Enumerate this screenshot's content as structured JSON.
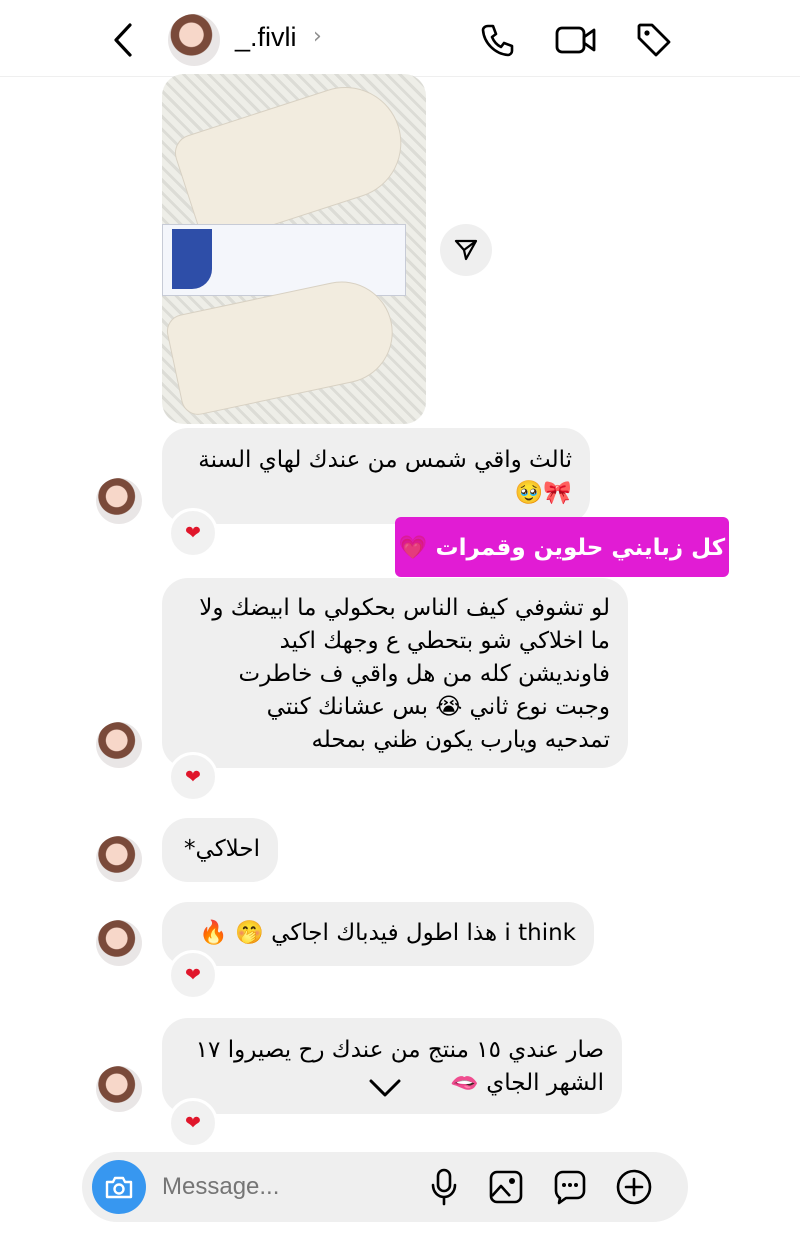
{
  "header": {
    "username": "_.fivli",
    "chevron": "›"
  },
  "icons": {
    "back": "chevron-left-icon",
    "call": "phone-icon",
    "video": "video-camera-icon",
    "tag": "tag-icon",
    "share": "send-icon",
    "camera": "camera-icon",
    "mic": "microphone-icon",
    "gallery": "image-icon",
    "sticker": "sticker-icon",
    "add": "plus-icon"
  },
  "messages": [
    {
      "lines": [
        "ثالث واقي شمس من عندك لهاي السنة",
        "🎀🥹"
      ],
      "reaction": "❤"
    },
    {
      "lines": [
        "لو تشوفي كيف الناس بحكولي ما ابيضك ولا",
        "ما اخلاكي شو بتحطي ع وجهك اكيد",
        "فاونديشن كله من هل واقي ف خاطرت",
        "وجبت نوع ثاني 😭 بس عشانك كنتي",
        "تمدحيه ويارب يكون ظني بمحله"
      ],
      "reaction": "❤"
    },
    {
      "lines": [
        "احلاكي*"
      ],
      "reaction": ""
    },
    {
      "lines": [
        "i think هذا اطول فيدباك اجاكي 🤭 🔥"
      ],
      "reaction": "❤"
    },
    {
      "lines": [
        "صار عندي ١٥ منتج من عندك رح يصيروا ١٧",
        "الشهر الجاي 🫦"
      ],
      "reaction": "❤"
    }
  ],
  "note": "كل زبايني حلوين وقمرات 💗",
  "composer": {
    "placeholder": "Message..."
  },
  "colors": {
    "accent": "#3797f0",
    "note_bg": "#e11cd4",
    "bubble_bg": "#efefef",
    "heart": "#e0162b"
  }
}
